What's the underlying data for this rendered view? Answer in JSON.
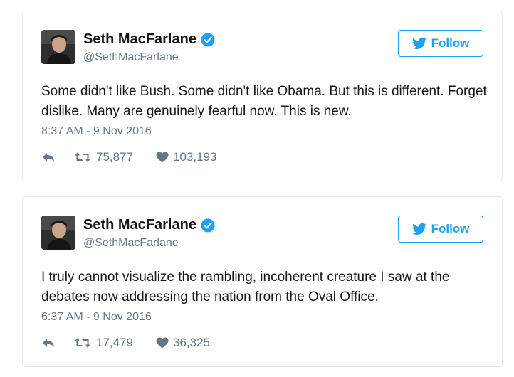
{
  "colors": {
    "accent": "#1da1f2",
    "text": "#14171a",
    "muted": "#657786",
    "border": "#e1e8ed"
  },
  "tweets": [
    {
      "author_name": "Seth MacFarlane",
      "author_handle": "@SethMacFarlane",
      "verified": true,
      "follow_label": "Follow",
      "text": "Some didn't like Bush. Some didn't like Obama. But this is different. Forget dislike. Many are genuinely fearful now. This is new.",
      "timestamp": "8:37 AM - 9 Nov 2016",
      "retweets": "75,877",
      "likes": "103,193",
      "icons": [
        "reply-icon",
        "retweet-icon",
        "heart-icon"
      ]
    },
    {
      "author_name": "Seth MacFarlane",
      "author_handle": "@SethMacFarlane",
      "verified": true,
      "follow_label": "Follow",
      "text": "I truly cannot visualize the rambling, incoherent creature I saw at the debates now addressing the nation from the Oval Office.",
      "timestamp": "6:37 AM - 9 Nov 2016",
      "retweets": "17,479",
      "likes": "36,325",
      "icons": [
        "reply-icon",
        "retweet-icon",
        "heart-icon"
      ]
    }
  ]
}
